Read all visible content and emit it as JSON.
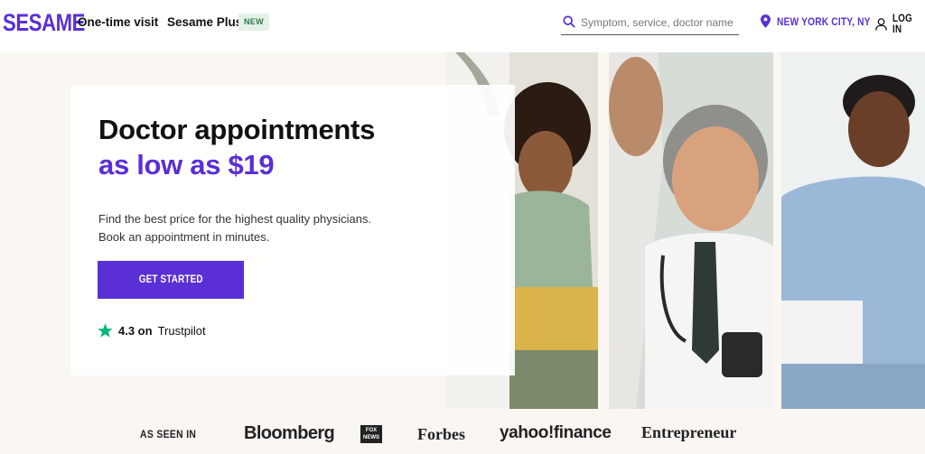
{
  "header": {
    "logo": "SESAME",
    "nav": {
      "one_time": "One-time visit",
      "plus": "Sesame Plus",
      "new_badge": "NEW"
    },
    "search": {
      "placeholder": "Symptom, service, doctor name"
    },
    "location": "NEW YORK CITY, NY",
    "login": "LOG IN"
  },
  "hero": {
    "title": "Doctor appointments",
    "price_line": "as low as $19",
    "subtitle_line1": "Find the best price for the highest quality physicians.",
    "subtitle_line2": "Book an appointment in minutes.",
    "cta": "GET STARTED",
    "trust_rating": "4.3 on",
    "trust_source": "Trustpilot"
  },
  "press": {
    "label": "AS SEEN IN",
    "logos": {
      "bloomberg": "Bloomberg",
      "foxnews_1": "FOX",
      "foxnews_2": "NEWS",
      "forbes": "Forbes",
      "yahoo": "yahoo!finance",
      "entrepreneur": "Entrepreneur"
    }
  },
  "colors": {
    "brand": "#5a2fd6",
    "trustpilot": "#00b67a",
    "badge_bg": "#e4f1e7"
  },
  "icons": {
    "search": "search-icon",
    "location": "pin-icon",
    "login": "user-icon",
    "trustpilot": "star-icon"
  }
}
